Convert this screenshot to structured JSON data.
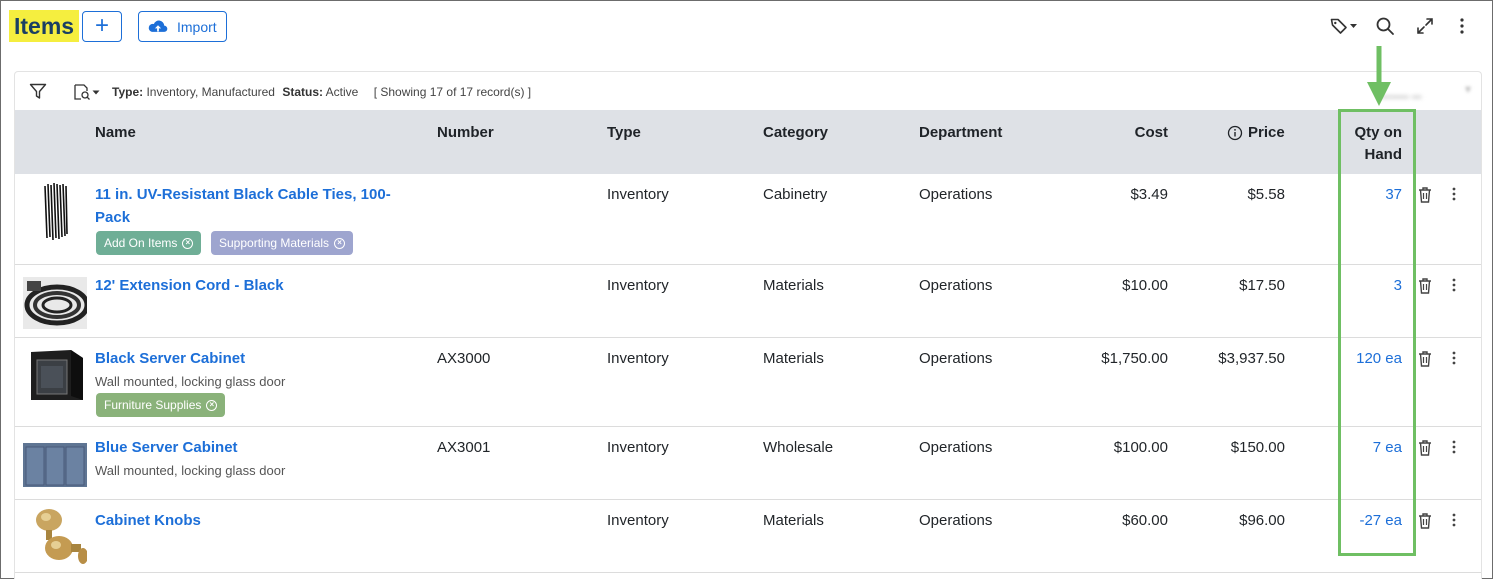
{
  "header": {
    "title": "Items",
    "add_label": "+",
    "import_label": "Import"
  },
  "filter": {
    "type_label": "Type:",
    "type_value": "Inventory, Manufactured",
    "status_label": "Status:",
    "status_value": "Active",
    "showing": "[ Showing 17 of 17 record(s) ]"
  },
  "columns": {
    "name": "Name",
    "number": "Number",
    "type": "Type",
    "category": "Category",
    "department": "Department",
    "cost": "Cost",
    "price": "Price",
    "qty_line1": "Qty on",
    "qty_line2": "Hand"
  },
  "rows": [
    {
      "name": "11 in. UV-Resistant Black Cable Ties, 100-Pack",
      "number": "",
      "type": "Inventory",
      "category": "Cabinetry",
      "department": "Operations",
      "cost": "$3.49",
      "price": "$5.58",
      "qty": "37",
      "tags": [
        "Add On Items",
        "Supporting Materials"
      ]
    },
    {
      "name": "12' Extension Cord - Black",
      "number": "",
      "type": "Inventory",
      "category": "Materials",
      "department": "Operations",
      "cost": "$10.00",
      "price": "$17.50",
      "qty": "3"
    },
    {
      "name": "Black Server Cabinet",
      "description": "Wall mounted, locking glass door",
      "number": "AX3000",
      "type": "Inventory",
      "category": "Materials",
      "department": "Operations",
      "cost": "$1,750.00",
      "price": "$3,937.50",
      "qty": "120 ea",
      "tags": [
        "Furniture Supplies"
      ]
    },
    {
      "name": "Blue Server Cabinet",
      "description": "Wall mounted, locking glass door",
      "number": "AX3001",
      "type": "Inventory",
      "category": "Wholesale",
      "department": "Operations",
      "cost": "$100.00",
      "price": "$150.00",
      "qty": "7 ea"
    },
    {
      "name": "Cabinet Knobs",
      "number": "",
      "type": "Inventory",
      "category": "Materials",
      "department": "Operations",
      "cost": "$60.00",
      "price": "$96.00",
      "qty": "-27 ea"
    }
  ],
  "colors": {
    "link": "#1d6fd8",
    "title_highlight": "#f5ee3f",
    "annotation": "#6fbf63",
    "header_bg": "#dee1e6"
  },
  "icons": [
    "plus-icon",
    "cloud-upload-icon",
    "tag-icon",
    "search-icon",
    "expand-icon",
    "kebab-icon",
    "filter-icon",
    "view-icon",
    "info-icon",
    "trash-icon"
  ]
}
